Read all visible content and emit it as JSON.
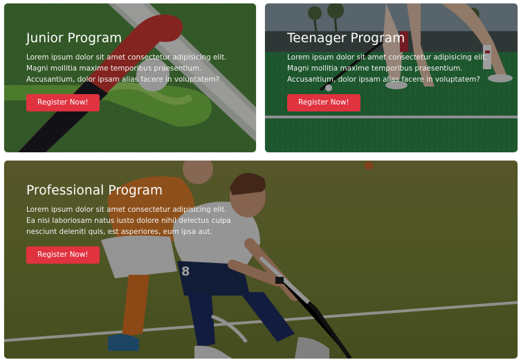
{
  "colors": {
    "accent": "#e0323f",
    "turf": "#3f7a3a"
  },
  "cards": [
    {
      "title": "Junior Program",
      "text": "Lorem ipsum dolor sit amet consectetur adipisicing elit. Magni mollitia maxime temporibus praesentium. Accusantium, dolor ipsam alias facere in voluptatem?",
      "button": "Register Now!"
    },
    {
      "title": "Teenager Program",
      "text": "Lorem ipsum dolor sit amet consectetur adipisicing elit. Magni mollitia maxime temporibus praesentium. Accusantium, dolor ipsam alias facere in voluptatem?",
      "button": "Register Now!"
    },
    {
      "title": "Professional Program",
      "text": "Lorem ipsum dolor sit amet consectetur adipisicing elit. Ea nisi laboriosam natus iusto dolore nihil delectus culpa nesciunt deleniti quis, est asperiores, eum ipsa aut.",
      "button": "Register Now!"
    }
  ]
}
